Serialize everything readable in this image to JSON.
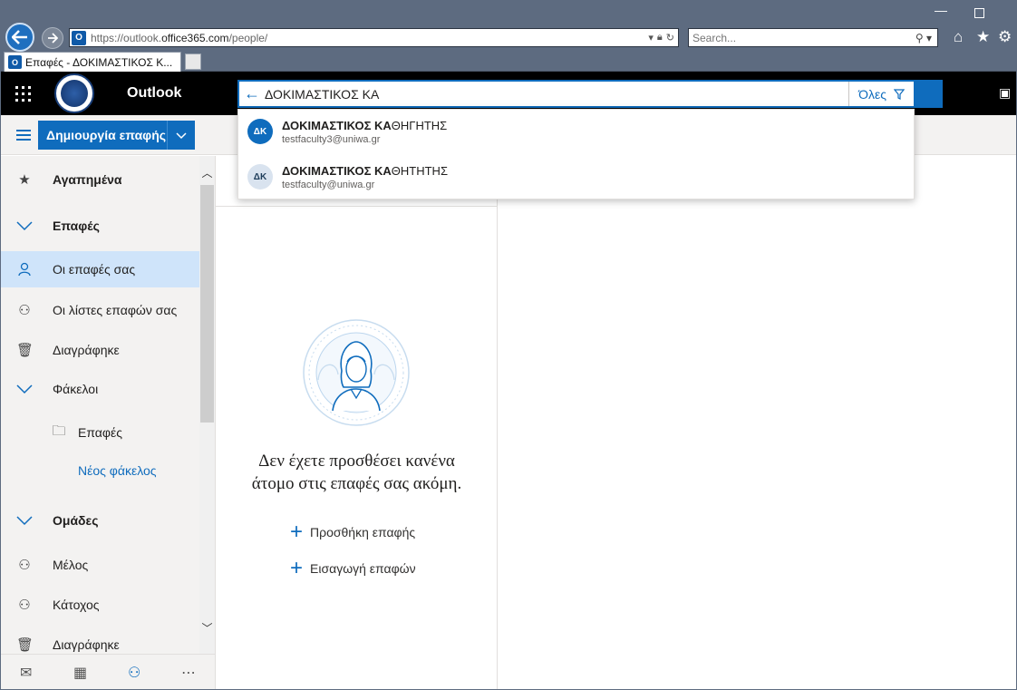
{
  "browser": {
    "address_url_scheme": "https://",
    "address_url_host_prefix": "outlook.",
    "address_url_host": "office365.com",
    "address_url_path": "/people/",
    "search_placeholder": "Search...",
    "tab_title": "Επαφές - ΔΟΚΙΜΑΣΤΙΚΟΣ Κ...",
    "favicon_letter": "O"
  },
  "header": {
    "app_name": "Outlook",
    "search_value": "ΔΟΚΙΜΑΣΤΙΚΟΣ ΚΑ",
    "scope_label": "Όλες"
  },
  "suggestions": [
    {
      "initials": "ΔΚ",
      "name_match": "ΔΟΚΙΜΑΣΤΙΚΟΣ ΚΑ",
      "name_rest": "ΘΗΓΗΤΗΣ",
      "email": "testfaculty3@uniwa.gr",
      "avatar_color": "#0f6cbd"
    },
    {
      "initials": "ΔΚ",
      "name_match": "ΔΟΚΙΜΑΣΤΙΚΟΣ ΚΑ",
      "name_rest": "ΘΗΤΗΤΗΣ",
      "email": "testfaculty@uniwa.gr",
      "avatar_color": "#d9e3ef"
    }
  ],
  "commands": {
    "new_contact": "Δημιουργία επαφής"
  },
  "nav": {
    "favorites": "Αγαπημένα",
    "contacts_header": "Επαφές",
    "your_contacts": "Οι επαφές σας",
    "your_lists": "Οι λίστες επαφών σας",
    "deleted": "Διαγράφηκε",
    "folders": "Φάκελοι",
    "folder_contacts": "Επαφές",
    "new_folder": "Νέος φάκελος",
    "groups": "Ομάδες",
    "member": "Μέλος",
    "owner": "Κάτοχος",
    "deleted_groups": "Διαγράφηκε"
  },
  "empty_state": {
    "line1": "Δεν έχετε προσθέσει κανένα",
    "line2": "άτομο στις επαφές σας ακόμη.",
    "add_contact": "Προσθήκη επαφής",
    "import_contacts": "Εισαγωγή επαφών"
  },
  "colors": {
    "accent": "#0f6cbd",
    "selected_bg": "#cfe4fa"
  }
}
